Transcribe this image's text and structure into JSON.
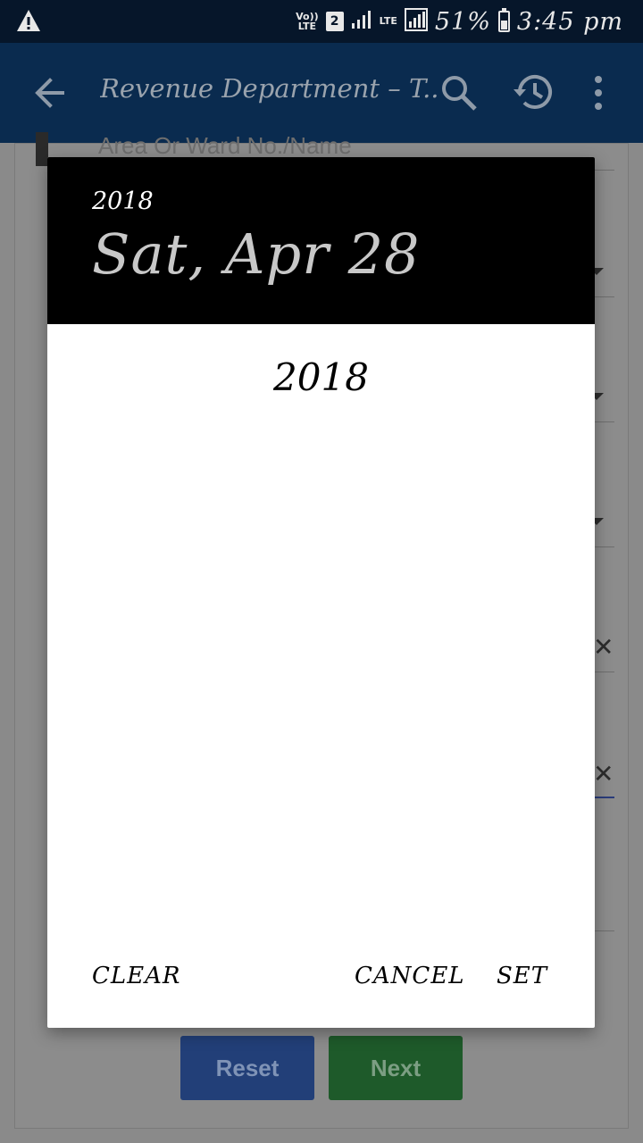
{
  "status_bar": {
    "volte_line1": "Vo))",
    "volte_line2": "LTE",
    "sim_slot": "2",
    "network": "LTE",
    "battery": "51%",
    "battery_level": 0.51,
    "time": "3:45 pm"
  },
  "app_bar": {
    "title": "Revenue Department – T...",
    "icons": [
      "back-arrow-icon",
      "search-icon",
      "history-icon",
      "more-vert-icon"
    ]
  },
  "background_form": {
    "field_placeholder": "Area Or Ward No./Name",
    "reset_label": "Reset",
    "next_label": "Next"
  },
  "date_picker": {
    "header_year": "2018",
    "header_date": "Sat, Apr 28",
    "selected_year": "2018",
    "clear_label": "CLEAR",
    "cancel_label": "CANCEL",
    "set_label": "SET"
  },
  "colors": {
    "status_bar": "#06162a",
    "app_bar": "#0a2b4f",
    "dialog_header": "#000000",
    "dialog_body": "#ffffff",
    "reset_button": "#223f78",
    "next_button": "#1e5a2a"
  }
}
